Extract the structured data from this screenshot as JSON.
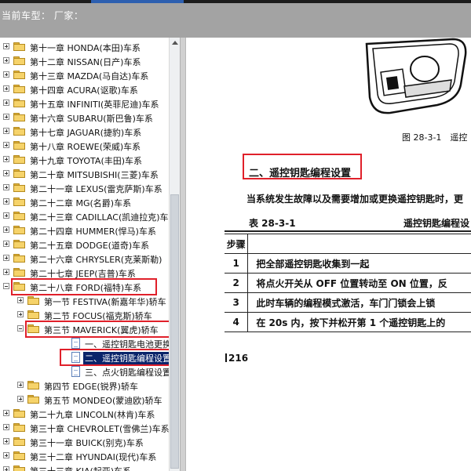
{
  "header": {
    "label": "当前车型： 厂家："
  },
  "tree": [
    {
      "label": "第十一章 HONDA(本田)车系",
      "level": 0,
      "type": "folder",
      "expander": "plus"
    },
    {
      "label": "第十二章 NISSAN(日产)车系",
      "level": 0,
      "type": "folder",
      "expander": "plus"
    },
    {
      "label": "第十三章 MAZDA(马自达)车系",
      "level": 0,
      "type": "folder",
      "expander": "plus"
    },
    {
      "label": "第十四章 ACURA(讴歌)车系",
      "level": 0,
      "type": "folder",
      "expander": "plus"
    },
    {
      "label": "第十五章 INFINITI(英菲尼迪)车系",
      "level": 0,
      "type": "folder",
      "expander": "plus"
    },
    {
      "label": "第十六章 SUBARU(斯巴鲁)车系",
      "level": 0,
      "type": "folder",
      "expander": "plus"
    },
    {
      "label": "第十七章 JAGUAR(捷豹)车系",
      "level": 0,
      "type": "folder",
      "expander": "plus"
    },
    {
      "label": "第十八章 ROEWE(荣威)车系",
      "level": 0,
      "type": "folder",
      "expander": "plus"
    },
    {
      "label": "第十九章 TOYOTA(丰田)车系",
      "level": 0,
      "type": "folder",
      "expander": "plus"
    },
    {
      "label": "第二十章 MITSUBISHI(三菱)车系",
      "level": 0,
      "type": "folder",
      "expander": "plus"
    },
    {
      "label": "第二十一章 LEXUS(雷克萨斯)车系",
      "level": 0,
      "type": "folder",
      "expander": "plus"
    },
    {
      "label": "第二十二章 MG(名爵)车系",
      "level": 0,
      "type": "folder",
      "expander": "plus"
    },
    {
      "label": "第二十三章 CADILLAC(凯迪拉克)车",
      "level": 0,
      "type": "folder",
      "expander": "plus"
    },
    {
      "label": "第二十四章 HUMMER(悍马)车系",
      "level": 0,
      "type": "folder",
      "expander": "plus"
    },
    {
      "label": "第二十五章 DODGE(道奇)车系",
      "level": 0,
      "type": "folder",
      "expander": "plus"
    },
    {
      "label": "第二十六章 CHRYSLER(克莱斯勒)",
      "level": 0,
      "type": "folder",
      "expander": "plus"
    },
    {
      "label": "第二十七章 JEEP(吉普)车系",
      "level": 0,
      "type": "folder",
      "expander": "plus"
    },
    {
      "label": "第二十八章 FORD(福特)车系",
      "level": 0,
      "type": "folder",
      "expander": "minus",
      "boxed": true
    },
    {
      "label": "第一节 FESTIVA(新嘉年华)轿车",
      "level": 1,
      "type": "folder",
      "expander": "plus"
    },
    {
      "label": "第二节 FOCUS(福克斯)轿车",
      "level": 1,
      "type": "folder",
      "expander": "plus"
    },
    {
      "label": "第三节 MAVERICK(翼虎)轿车",
      "level": 1,
      "type": "folder",
      "expander": "minus",
      "boxed": true
    },
    {
      "label": "一、遥控钥匙电池更换",
      "level": 2,
      "type": "doc"
    },
    {
      "label": "二、遥控钥匙编程设置",
      "level": 2,
      "type": "doc",
      "selected": true,
      "boxed": true
    },
    {
      "label": "三、点火钥匙编程设置",
      "level": 2,
      "type": "doc"
    },
    {
      "label": "第四节 EDGE(锐界)轿车",
      "level": 1,
      "type": "folder",
      "expander": "plus"
    },
    {
      "label": "第五节 MONDEO(蒙迪欧)轿车",
      "level": 1,
      "type": "folder",
      "expander": "plus"
    },
    {
      "label": "第二十九章 LINCOLN(林肯)车系",
      "level": 0,
      "type": "folder",
      "expander": "plus"
    },
    {
      "label": "第三十章 CHEVROLET(雪佛兰)车系",
      "level": 0,
      "type": "folder",
      "expander": "plus"
    },
    {
      "label": "第三十一章 BUICK(别克)车系",
      "level": 0,
      "type": "folder",
      "expander": "plus"
    },
    {
      "label": "第三十二章 HYUNDAI(现代)车系",
      "level": 0,
      "type": "folder",
      "expander": "plus"
    },
    {
      "label": "第三十三章 KIA(起亚)车系",
      "level": 0,
      "type": "folder",
      "expander": "plus"
    }
  ],
  "document": {
    "figure_caption": "图 28-3-1　遥控",
    "section_title": "二、遥控钥匙编程设置",
    "intro": "当系统发生故障以及需要增加或更换遥控钥匙时，更",
    "table_label": "表 28-3-1",
    "table_title": "遥控钥匙编程设",
    "col_step": "步骤",
    "steps": [
      {
        "n": "1",
        "text": "把全部遥控钥匙收集到一起"
      },
      {
        "n": "2",
        "text": "将点火开关从 OFF 位置转动至 ON 位置，反"
      },
      {
        "n": "3",
        "text": "此时车辆的编程模式激活，车门门锁会上锁"
      },
      {
        "n": "4",
        "text": "在 20s 内，按下并松开第 1 个遥控钥匙上的"
      }
    ],
    "page_number": "216"
  },
  "colors": {
    "highlight_box": "#e0202a",
    "header_bg": "#a3a3a3",
    "selection": "#0a246a"
  }
}
